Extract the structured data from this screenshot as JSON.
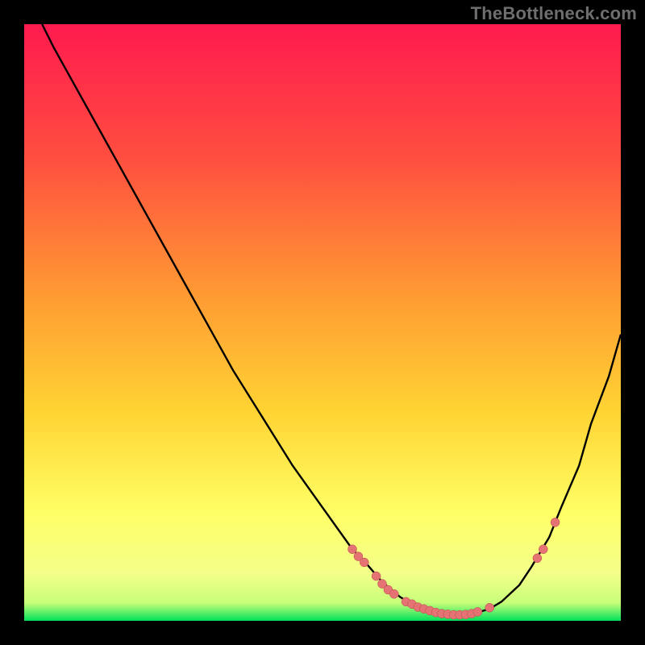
{
  "attribution": "TheBottleneck.com",
  "colors": {
    "gradient_top": "#ff1a4f",
    "gradient_upper_mid": "#ff6a33",
    "gradient_mid": "#ffd433",
    "gradient_lower_mid": "#ffff66",
    "gradient_low": "#f4ff8a",
    "gradient_bottom": "#00e05a",
    "curve": "#000000",
    "dot_fill": "#e57373",
    "dot_stroke": "#b84a4a"
  },
  "chart_data": {
    "type": "line",
    "title": "",
    "xlabel": "",
    "ylabel": "",
    "xlim": [
      0,
      100
    ],
    "ylim": [
      0,
      100
    ],
    "curve": {
      "x": [
        3,
        5,
        10,
        15,
        20,
        25,
        30,
        35,
        40,
        45,
        50,
        55,
        57,
        60,
        63,
        65,
        68,
        70,
        72,
        75,
        78,
        80,
        83,
        85,
        88,
        90,
        93,
        95,
        98,
        100
      ],
      "y": [
        100,
        96,
        87,
        78,
        69,
        60,
        51,
        42,
        34,
        26,
        19,
        12,
        10,
        6.5,
        4,
        2.8,
        1.8,
        1.2,
        1,
        1.1,
        2,
        3.2,
        6,
        9,
        14,
        19,
        26,
        33,
        41,
        48
      ]
    },
    "dots": [
      {
        "x": 55,
        "y": 12
      },
      {
        "x": 56,
        "y": 10.8
      },
      {
        "x": 57,
        "y": 9.8
      },
      {
        "x": 59,
        "y": 7.5
      },
      {
        "x": 60,
        "y": 6.2
      },
      {
        "x": 61,
        "y": 5.2
      },
      {
        "x": 62,
        "y": 4.5
      },
      {
        "x": 64,
        "y": 3.2
      },
      {
        "x": 65,
        "y": 2.8
      },
      {
        "x": 66,
        "y": 2.3
      },
      {
        "x": 67,
        "y": 2.0
      },
      {
        "x": 68,
        "y": 1.7
      },
      {
        "x": 69,
        "y": 1.4
      },
      {
        "x": 70,
        "y": 1.2
      },
      {
        "x": 71,
        "y": 1.1
      },
      {
        "x": 72,
        "y": 1.0
      },
      {
        "x": 73,
        "y": 1.0
      },
      {
        "x": 74,
        "y": 1.05
      },
      {
        "x": 75,
        "y": 1.2
      },
      {
        "x": 76,
        "y": 1.5
      },
      {
        "x": 78,
        "y": 2.2
      },
      {
        "x": 86,
        "y": 10.5
      },
      {
        "x": 87,
        "y": 12
      },
      {
        "x": 89,
        "y": 16.5
      }
    ]
  }
}
